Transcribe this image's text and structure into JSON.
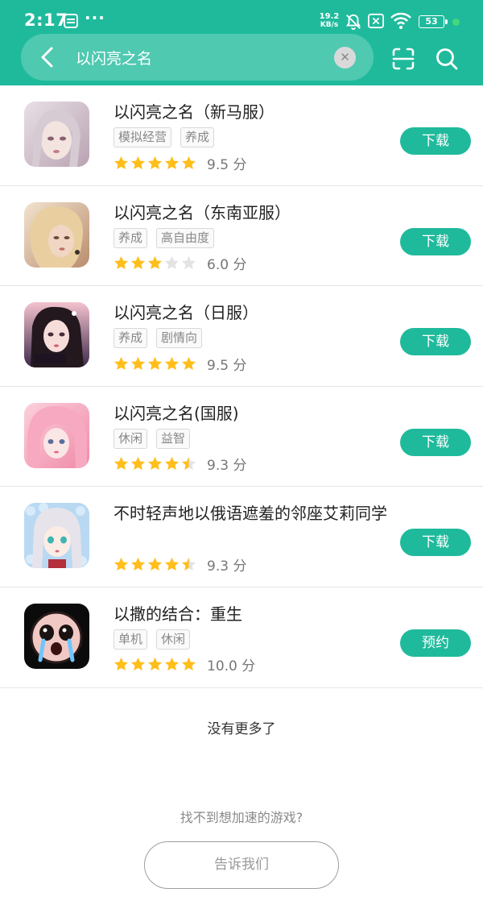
{
  "status_bar": {
    "time": "2:17",
    "more": "···",
    "net_speed_value": "19.2",
    "net_speed_unit": "KB/s",
    "battery": "53"
  },
  "search": {
    "query": "以闪亮之名"
  },
  "results": [
    {
      "title": "以闪亮之名（新马服）",
      "tags": [
        "模拟经营",
        "养成"
      ],
      "rating": 5,
      "score": "9.5 分",
      "action": "下载"
    },
    {
      "title": "以闪亮之名（东南亚服）",
      "tags": [
        "养成",
        "高自由度"
      ],
      "rating": 3,
      "score": "6.0 分",
      "action": "下载"
    },
    {
      "title": "以闪亮之名（日服）",
      "tags": [
        "养成",
        "剧情向"
      ],
      "rating": 5,
      "score": "9.5 分",
      "action": "下载"
    },
    {
      "title": "以闪亮之名(国服)",
      "tags": [
        "休闲",
        "益智"
      ],
      "rating": 4.5,
      "score": "9.3 分",
      "action": "下载"
    },
    {
      "title": "不时轻声地以俄语遮羞的邻座艾莉同学",
      "tags": [],
      "rating": 4.5,
      "score": "9.3 分",
      "action": "下载"
    },
    {
      "title": "以撒的结合：重生",
      "tags": [
        "单机",
        "休闲"
      ],
      "rating": 5,
      "score": "10.0 分",
      "action": "预约"
    }
  ],
  "footer": {
    "no_more": "没有更多了",
    "hint": "找不到想加速的游戏?",
    "tell_us": "告诉我们"
  },
  "colors": {
    "accent": "#1fba9c",
    "star_on": "#ffbe1a",
    "star_off": "#e3e3e3"
  }
}
